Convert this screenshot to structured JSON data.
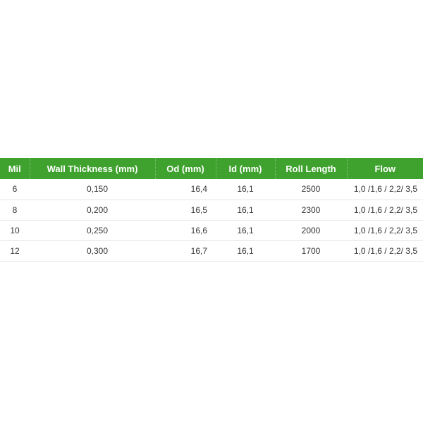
{
  "table": {
    "headers": [
      "Mil",
      "Wall Thickness (mm)",
      "Od (mm)",
      "Id (mm)",
      "Roll Length",
      "Flow"
    ],
    "rows": [
      [
        "6",
        "0,150",
        "16,4",
        "16,1",
        "2500",
        "1,0 /1,6 / 2,2/ 3,5"
      ],
      [
        "8",
        "0,200",
        "16,5",
        "16,1",
        "2300",
        "1,0 /1,6 / 2,2/ 3,5"
      ],
      [
        "10",
        "0,250",
        "16,6",
        "16,1",
        "2000",
        "1,0 /1,6 / 2,2/ 3,5"
      ],
      [
        "12",
        "0,300",
        "16,7",
        "16,1",
        "1700",
        "1,0 /1,6 / 2,2/ 3,5"
      ]
    ]
  },
  "colors": {
    "header_bg": "#3fa22e",
    "header_text": "#ffffff",
    "cell_text": "#333333",
    "row_divider": "#e6e6e6"
  }
}
